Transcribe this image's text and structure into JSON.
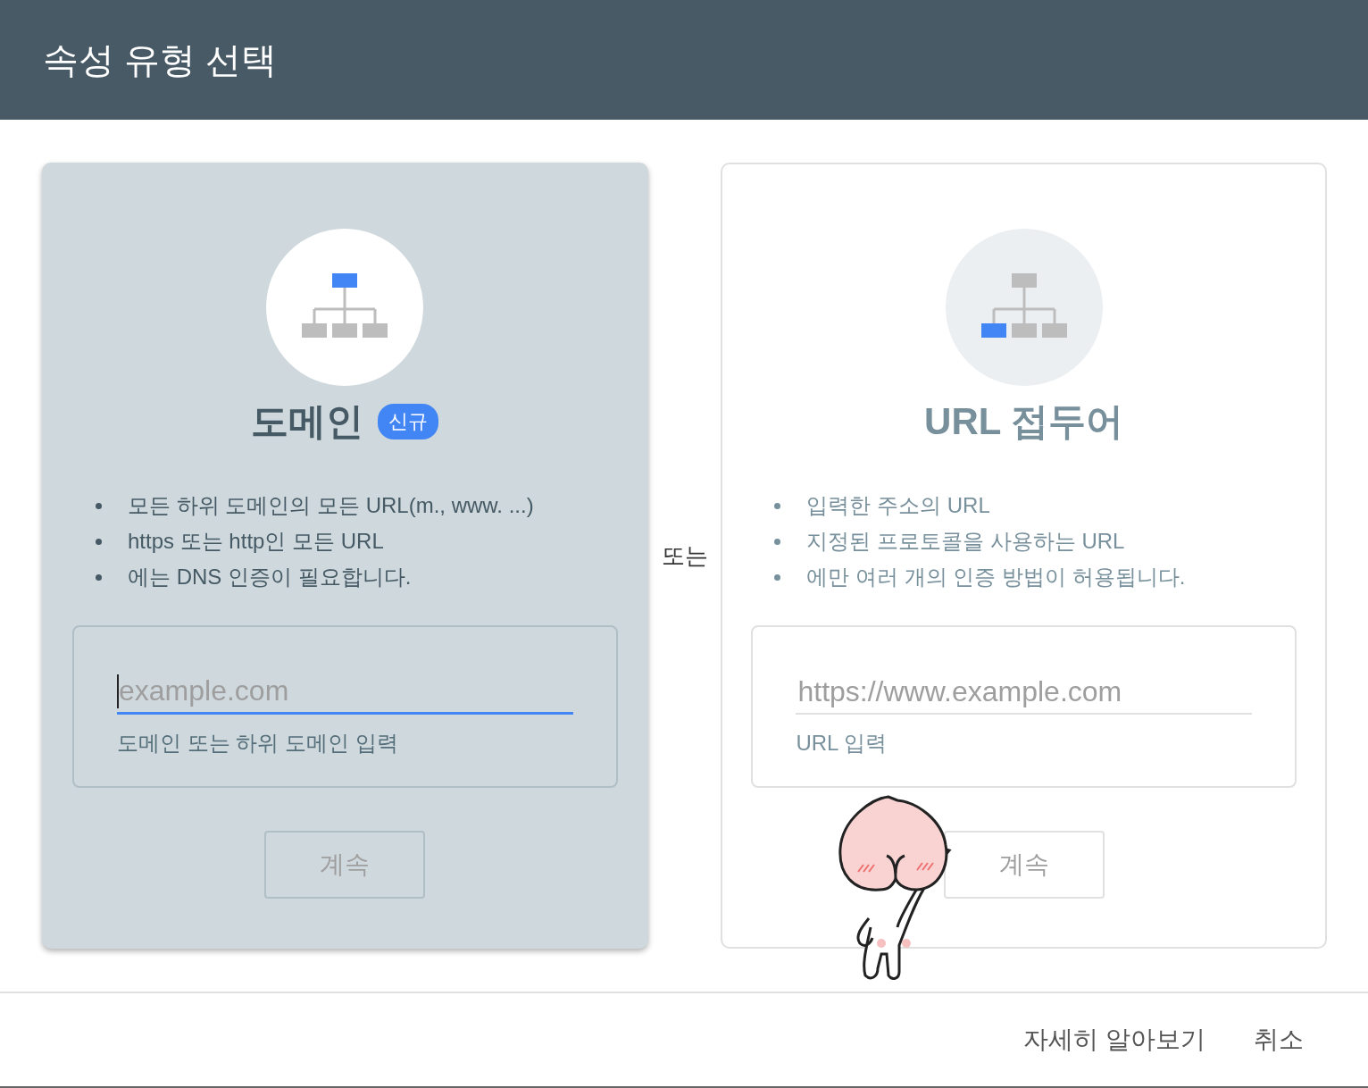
{
  "window": {
    "title": "속성 유형 선택"
  },
  "options": [
    {
      "title": "도메인",
      "badge": "신규",
      "selected": true,
      "root_highlighted": true,
      "bullets": [
        "모든 하위 도메인의 모든 URL(m., www. ...)",
        "https 또는 http인 모든 URL",
        "에는 DNS 인증이 필요합니다."
      ],
      "field": {
        "placeholder": "example.com",
        "helper": "도메인 또는 하위 도메인 입력",
        "focused": true
      },
      "button": "계속"
    },
    {
      "title": "URL 접두어",
      "selected": false,
      "root_highlighted": false,
      "bullets": [
        "입력한 주소의 URL",
        "지정된 프로토콜을 사용하는 URL",
        "에만 여러 개의 인증 방법이 허용됩니다."
      ],
      "field": {
        "placeholder": "https://www.example.com",
        "helper": "URL 입력",
        "focused": false
      },
      "button": "계속"
    }
  ],
  "separator": "또는",
  "footer": {
    "buttons": [
      "자세히 알아보기",
      "취소"
    ]
  }
}
